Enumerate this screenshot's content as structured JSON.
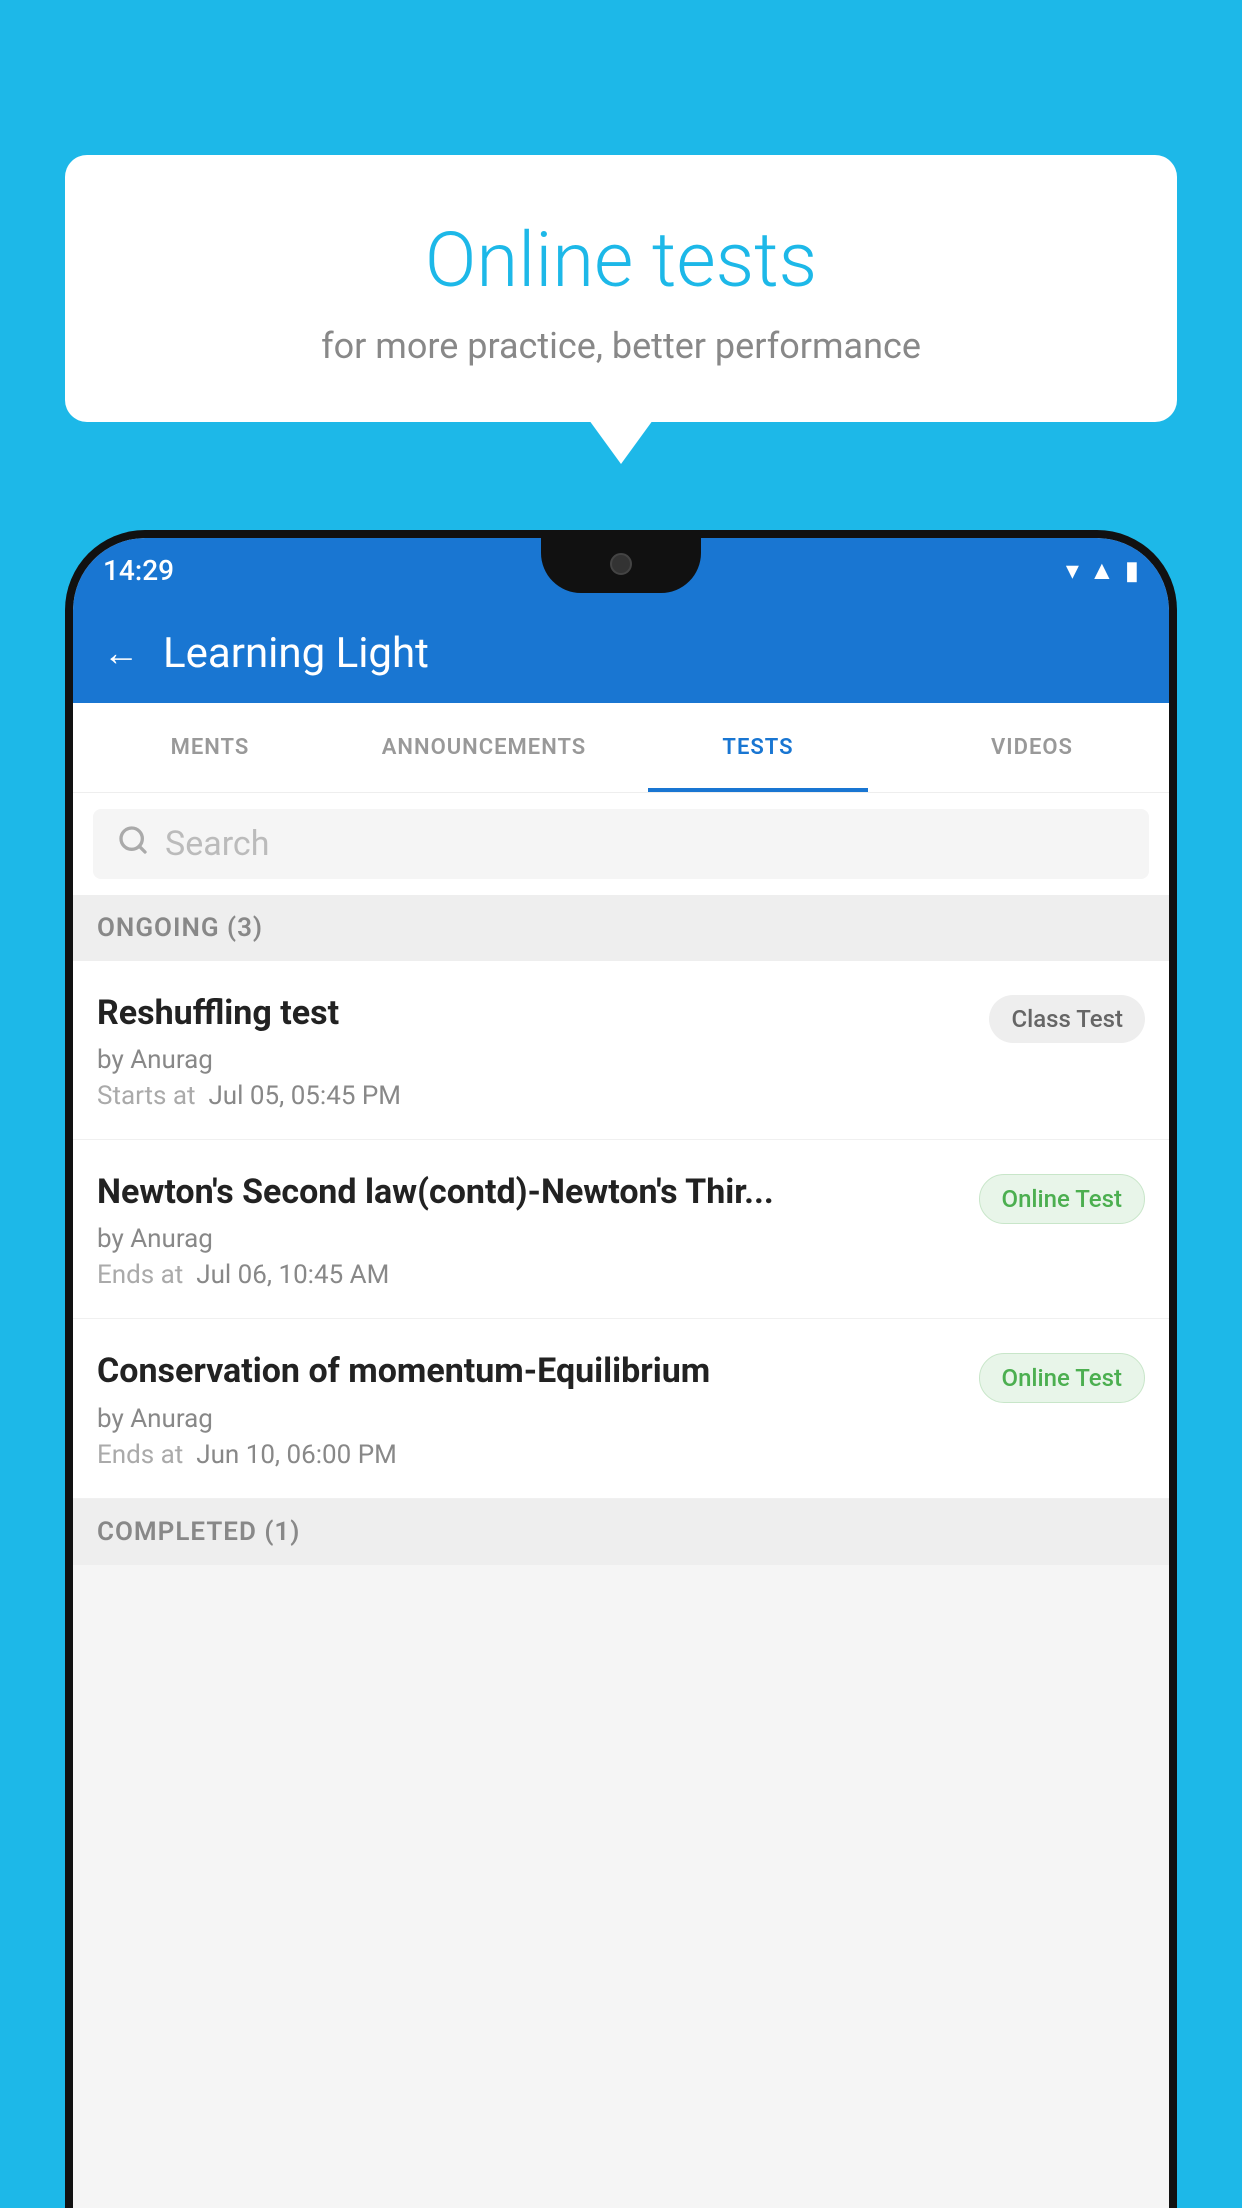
{
  "background": {
    "color": "#1DB8E8"
  },
  "speech_bubble": {
    "title": "Online tests",
    "subtitle": "for more practice, better performance"
  },
  "phone": {
    "status_bar": {
      "time": "14:29",
      "wifi": "▼",
      "signal": "▲",
      "battery": "▮"
    },
    "app_bar": {
      "title": "Learning Light",
      "back_label": "←"
    },
    "tabs": [
      {
        "label": "MENTS",
        "active": false
      },
      {
        "label": "ANNOUNCEMENTS",
        "active": false
      },
      {
        "label": "TESTS",
        "active": true
      },
      {
        "label": "VIDEOS",
        "active": false
      }
    ],
    "search": {
      "placeholder": "Search"
    },
    "sections": [
      {
        "label": "ONGOING (3)",
        "items": [
          {
            "name": "Reshuffling test",
            "author": "by Anurag",
            "time_label": "Starts at",
            "time": "Jul 05, 05:45 PM",
            "badge": "Class Test",
            "badge_type": "class"
          },
          {
            "name": "Newton's Second law(contd)-Newton's Thir...",
            "author": "by Anurag",
            "time_label": "Ends at",
            "time": "Jul 06, 10:45 AM",
            "badge": "Online Test",
            "badge_type": "online"
          },
          {
            "name": "Conservation of momentum-Equilibrium",
            "author": "by Anurag",
            "time_label": "Ends at",
            "time": "Jun 10, 06:00 PM",
            "badge": "Online Test",
            "badge_type": "online"
          }
        ]
      }
    ],
    "completed_section": {
      "label": "COMPLETED (1)"
    }
  }
}
